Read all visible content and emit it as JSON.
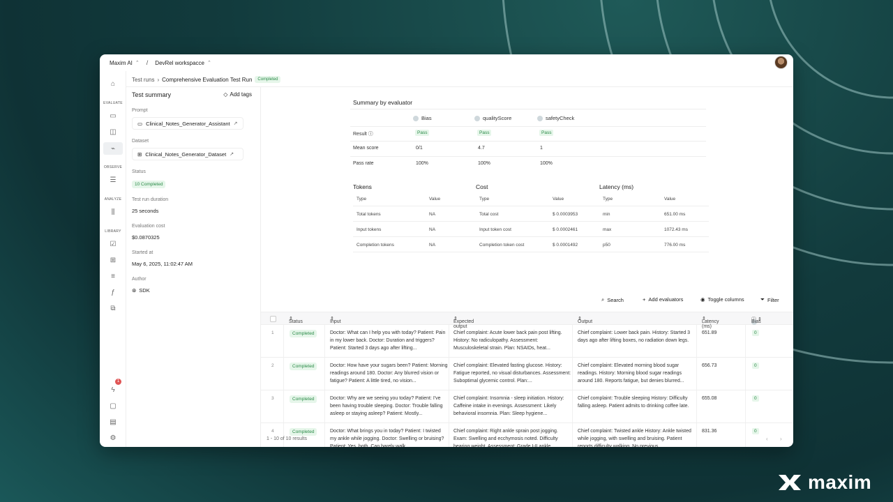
{
  "topbar": {
    "org": "Maxim AI",
    "separator": "/",
    "workspace": "DevRel workspacce"
  },
  "sidebar": {
    "sections": {
      "evaluate": "EVALUATE",
      "observe": "OBSERVE",
      "analyze": "ANALYZE",
      "library": "LIBRARY"
    },
    "notification_count": "1"
  },
  "breadcrumb": {
    "parent": "Test runs",
    "current": "Comprehensive Evaluation Test Run",
    "status": "Completed"
  },
  "summary": {
    "title": "Test summary",
    "add_tags": "Add tags",
    "prompt_label": "Prompt",
    "prompt_value": "Clinical_Notes_Generator_Assistant",
    "dataset_label": "Dataset",
    "dataset_value": "Clinical_Notes_Generator_Dataset",
    "status_label": "Status",
    "status_value": "10 Completed",
    "duration_label": "Test run duration",
    "duration_value": "25 seconds",
    "cost_label": "Evaluation cost",
    "cost_value": "$0.0870325",
    "started_label": "Started at",
    "started_value": "May 6, 2025, 11:02:47 AM",
    "author_label": "Author",
    "author_value": "SDK"
  },
  "evaluators": {
    "title": "Summary by evaluator",
    "names": [
      "Bias",
      "qualityScore",
      "safetyCheck"
    ],
    "row_labels": {
      "result": "Result",
      "mean": "Mean score",
      "pass_rate": "Pass rate"
    },
    "results": [
      "Pass",
      "Pass",
      "Pass"
    ],
    "mean_scores": [
      "0/1",
      "4.7",
      "1"
    ],
    "pass_rates": [
      "100%",
      "100%",
      "100%"
    ]
  },
  "metrics": {
    "tokens": {
      "title": "Tokens",
      "type_header": "Type",
      "value_header": "Value",
      "rows": [
        {
          "type": "Total tokens",
          "value": "NA"
        },
        {
          "type": "Input tokens",
          "value": "NA"
        },
        {
          "type": "Completion tokens",
          "value": "NA"
        }
      ]
    },
    "cost": {
      "title": "Cost",
      "type_header": "Type",
      "value_header": "Value",
      "rows": [
        {
          "type": "Total cost",
          "value": "$ 0.0003953"
        },
        {
          "type": "Input token cost",
          "value": "$ 0.0002461"
        },
        {
          "type": "Completion token cost",
          "value": "$ 0.0001492"
        }
      ]
    },
    "latency": {
      "title": "Latency (ms)",
      "type_header": "Type",
      "value_header": "Value",
      "rows": [
        {
          "type": "min",
          "value": "651.00 ms"
        },
        {
          "type": "max",
          "value": "1072.43 ms"
        },
        {
          "type": "p50",
          "value": "776.00 ms"
        }
      ]
    }
  },
  "toolbar": {
    "search": "Search",
    "add_evaluators": "Add evaluators",
    "toggle_columns": "Toggle columns",
    "filter": "Filter"
  },
  "table": {
    "headers": {
      "status": "Status",
      "input": "Input",
      "expected": "Expected output",
      "output": "Output",
      "latency": "Latency (ms)",
      "bias": "Bias"
    },
    "rows": [
      {
        "num": "1",
        "status": "Completed",
        "input": "Doctor: What can I help you with today? Patient: Pain in my lower back. Doctor: Duration and triggers? Patient: Started 3 days ago after lifting...",
        "expected": "Chief complaint: Acute lower back pain post lifting. History: No radiculopathy. Assessment: Musculoskeletal strain. Plan: NSAIDs, heat...",
        "output": "Chief complaint: Lower back pain. History: Started 3 days ago after lifting boxes, no radiation down legs.",
        "latency": "651.89",
        "bias": "0"
      },
      {
        "num": "2",
        "status": "Completed",
        "input": "Doctor: How have your sugars been? Patient: Morning readings around 180. Doctor: Any blurred vision or fatigue? Patient: A little tired, no vision...",
        "expected": "Chief complaint: Elevated fasting glucose. History: Fatigue reported, no visual disturbances. Assessment: Suboptimal glycemic control. Plan:...",
        "output": "Chief complaint: Elevated morning blood sugar readings. History: Morning blood sugar readings around 180. Reports fatigue, but denies blurred...",
        "latency": "656.73",
        "bias": "0"
      },
      {
        "num": "3",
        "status": "Completed",
        "input": "Doctor: Why are we seeing you today? Patient: I've been having trouble sleeping. Doctor: Trouble falling asleep or staying asleep? Patient: Mostly...",
        "expected": "Chief complaint: Insomnia - sleep initiation. History: Caffeine intake in evenings. Assessment: Likely behavioral insomnia. Plan: Sleep hygiene...",
        "output": "Chief complaint: Trouble sleeping History: Difficulty falling asleep. Patient admits to drinking coffee late.",
        "latency": "655.08",
        "bias": "0"
      },
      {
        "num": "4",
        "status": "Completed",
        "input": "Doctor: What brings you in today? Patient: I twisted my ankle while jogging. Doctor: Swelling or bruising? Patient: Yes, both. Can barely walk....",
        "expected": "Chief complaint: Right ankle sprain post jogging. Exam: Swelling and ecchymosis noted. Difficulty bearing weight. Assessment: Grade I-II ankle...",
        "output": "Chief complaint: Twisted ankle History: Ankle twisted while jogging, with swelling and bruising. Patient reports difficulty walking. No previous...",
        "latency": "831.36",
        "bias": "0"
      }
    ],
    "footer": "1 - 10 of 10 results"
  },
  "brand": {
    "name": "maxim"
  },
  "colors": {
    "accent_green": "#2a8a47",
    "badge_bg": "#e6f6ea",
    "background": "#123b3d"
  }
}
